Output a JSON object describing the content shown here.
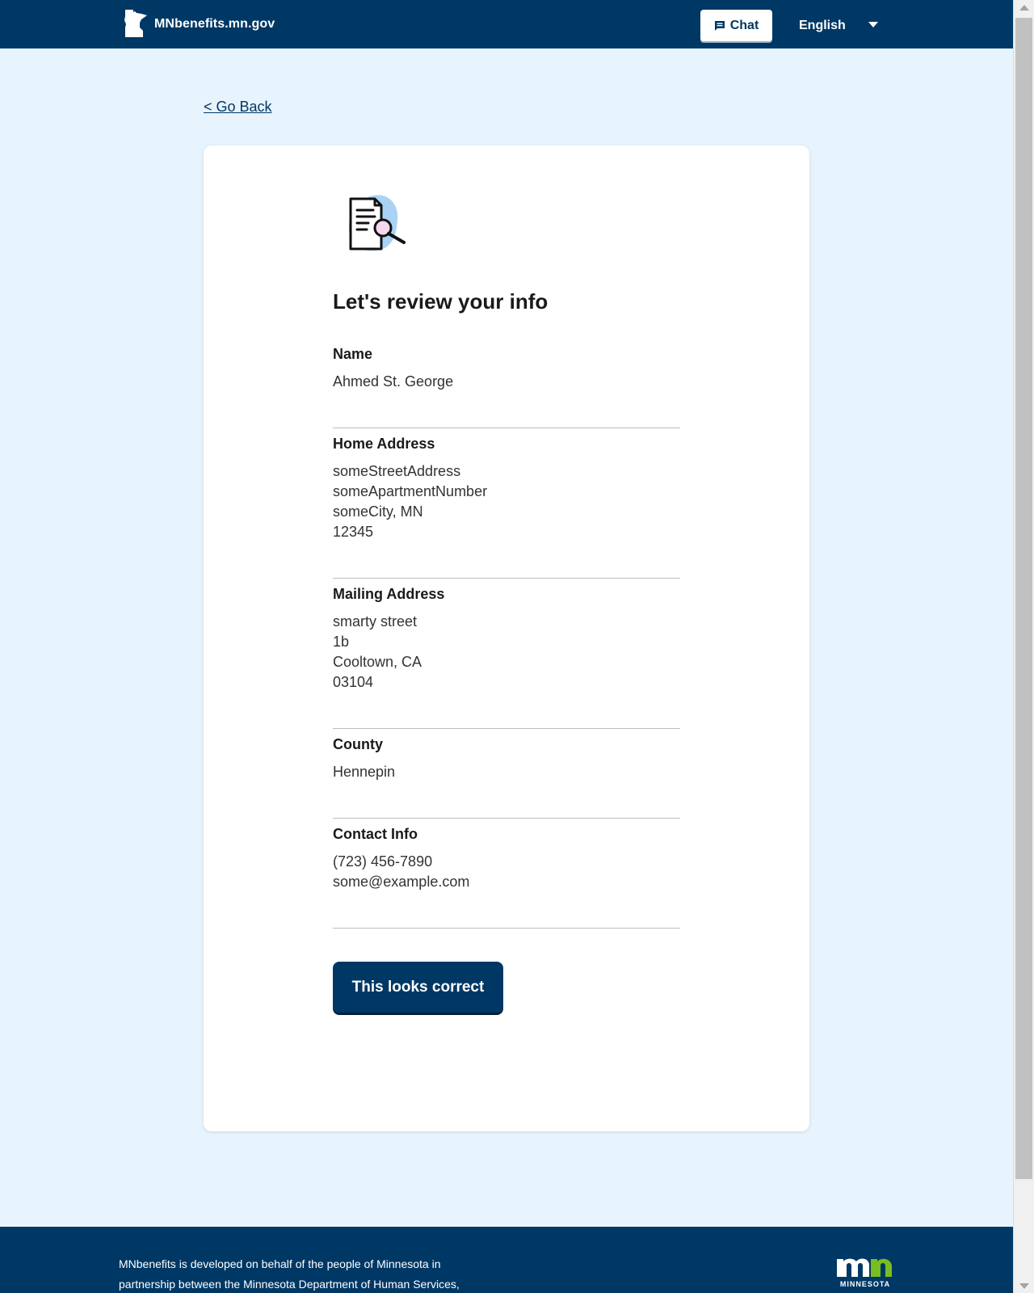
{
  "header": {
    "site_name": "MNbenefits.mn.gov",
    "chat_label": "Chat",
    "language": "English"
  },
  "nav": {
    "go_back": "< Go Back"
  },
  "card": {
    "title": "Let's review your info",
    "sections": [
      {
        "label": "Name",
        "lines": [
          "Ahmed St. George"
        ]
      },
      {
        "label": "Home Address",
        "lines": [
          "someStreetAddress",
          "someApartmentNumber",
          "someCity, MN",
          "12345"
        ]
      },
      {
        "label": "Mailing Address",
        "lines": [
          "smarty street",
          "1b",
          "Cooltown, CA",
          "03104"
        ]
      },
      {
        "label": "County",
        "lines": [
          "Hennepin"
        ]
      },
      {
        "label": "Contact Info",
        "lines": [
          "(723) 456-7890",
          "some@example.com"
        ]
      }
    ],
    "confirm_label": "This looks correct"
  },
  "footer": {
    "text_line1": "MNbenefits is developed on behalf of the people of Minnesota in",
    "text_line2": "partnership between the Minnesota Department of Human Services,",
    "logo_text": "MINNESOTA"
  },
  "colors": {
    "brand": "#003865",
    "background": "#e8f4fd",
    "accent_green": "#78be20",
    "icon_blob": "#a9d3f5"
  }
}
